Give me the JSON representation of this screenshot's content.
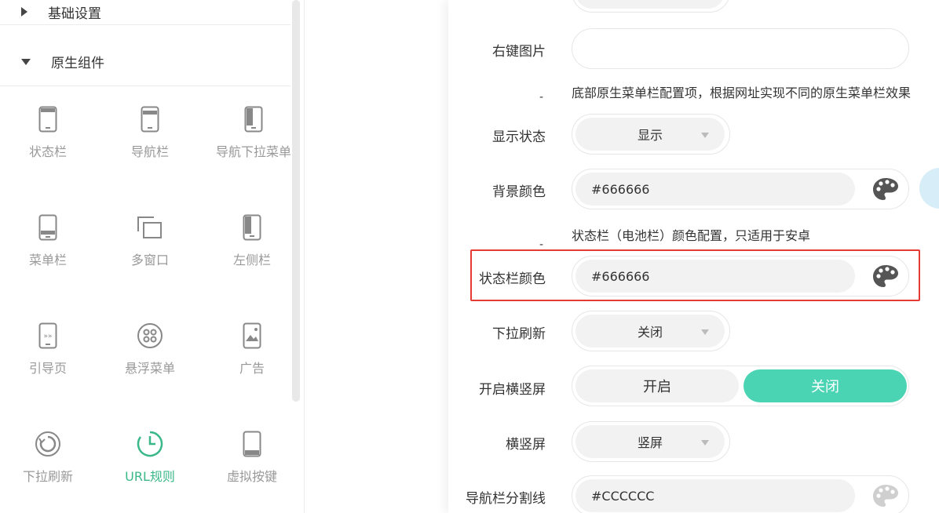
{
  "sidebar": {
    "sections": [
      {
        "title": "基础设置",
        "expanded": false
      },
      {
        "title": "原生组件",
        "expanded": true
      }
    ],
    "components": [
      {
        "label": "状态栏",
        "icon": "phone-statusbar-icon"
      },
      {
        "label": "导航栏",
        "icon": "phone-navbar-icon"
      },
      {
        "label": "导航下拉菜单",
        "icon": "phone-dropdown-icon"
      },
      {
        "label": "菜单栏",
        "icon": "phone-menubar-icon"
      },
      {
        "label": "多窗口",
        "icon": "multi-window-icon"
      },
      {
        "label": "左侧栏",
        "icon": "phone-leftbar-icon"
      },
      {
        "label": "引导页",
        "icon": "phone-guide-icon"
      },
      {
        "label": "悬浮菜单",
        "icon": "floating-menu-icon"
      },
      {
        "label": "广告",
        "icon": "phone-ad-icon"
      },
      {
        "label": "下拉刷新",
        "icon": "refresh-icon"
      },
      {
        "label": "URL规则",
        "icon": "clock-icon",
        "active": true
      },
      {
        "label": "虚拟按键",
        "icon": "phone-virtual-key-icon"
      }
    ]
  },
  "form": {
    "right_click_image": {
      "label": "右键图片",
      "value": ""
    },
    "bottom_menu_hint": "底部原生菜单栏配置项，根据网址实现不同的原生菜单栏效果",
    "display_state": {
      "label": "显示状态",
      "value": "显示"
    },
    "bg_color": {
      "label": "背景颜色",
      "value": "#666666"
    },
    "statusbar_hint": "状态栏（电池栏）颜色配置，只适用于安卓",
    "statusbar_color": {
      "label": "状态栏颜色",
      "value": "#666666"
    },
    "pull_refresh": {
      "label": "下拉刷新",
      "value": "关闭"
    },
    "orientation_toggle": {
      "label": "开启横竖屏",
      "on_label": "开启",
      "off_label": "关闭",
      "selected": "关闭"
    },
    "orientation": {
      "label": "横竖屏",
      "value": "竖屏"
    },
    "nav_divider": {
      "label": "导航栏分割线",
      "value": "#CCCCCC"
    },
    "dash": "-"
  },
  "colors": {
    "accent": "#4bd4b4",
    "active_text": "#3ab88a",
    "highlight": "#e53b35"
  }
}
